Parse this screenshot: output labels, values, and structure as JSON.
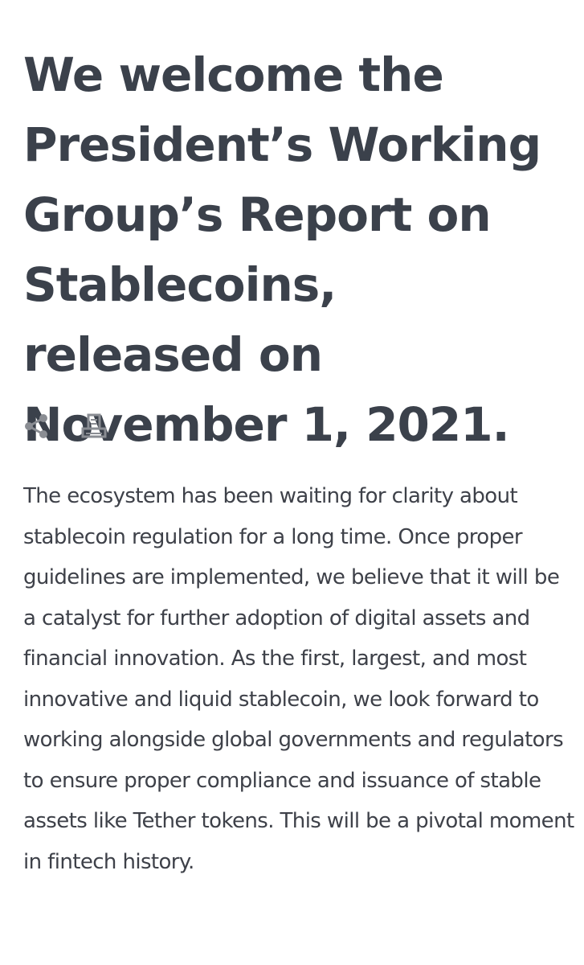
{
  "article": {
    "title": "We welcome the President’s Working Group’s Report on Stablecoins, released on November 1, 2021.",
    "body": "The ecosystem has been waiting for clarity about stablecoin regulation for a long time. Once proper guidelines are implemented, we believe that it will be a catalyst for further adoption of digital assets and financial innovation. As the first, largest, and most innovative and liquid stablecoin, we look forward to working alongside global governments and regulators to ensure proper compliance and issuance of stable assets like Tether tokens. This will be a pivotal moment in fintech history."
  },
  "toolbar": {
    "share_icon": "share-icon",
    "print_icon": "print-icon",
    "icon_color": "#8a8d93"
  },
  "colors": {
    "heading": "#3b414b",
    "text": "#3e4149",
    "background": "#ffffff"
  }
}
